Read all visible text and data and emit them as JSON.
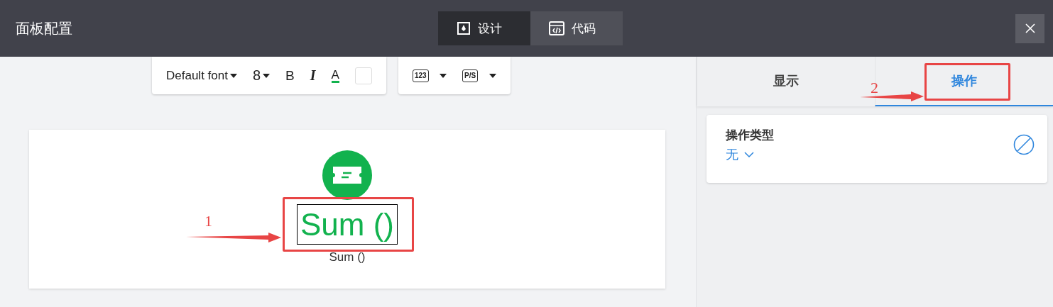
{
  "window": {
    "title": "面板配置"
  },
  "mode_tabs": [
    {
      "label": "设计",
      "kind": "design",
      "selected": true
    },
    {
      "label": "代码",
      "kind": "code",
      "selected": false
    }
  ],
  "toolbar": {
    "font": "Default font",
    "size": "8",
    "bold": "B",
    "italic": "I",
    "text_color": "A",
    "number_format": "123",
    "prefix_suffix": "P/S"
  },
  "widget": {
    "value": "Sum ()",
    "label": "Sum ()",
    "selected": true
  },
  "side_tabs": [
    {
      "label": "显示",
      "selected": false
    },
    {
      "label": "操作",
      "selected": true
    }
  ],
  "action": {
    "title": "操作类型",
    "value": "无"
  },
  "annotations": [
    {
      "number": "1"
    },
    {
      "number": "2"
    }
  ]
}
